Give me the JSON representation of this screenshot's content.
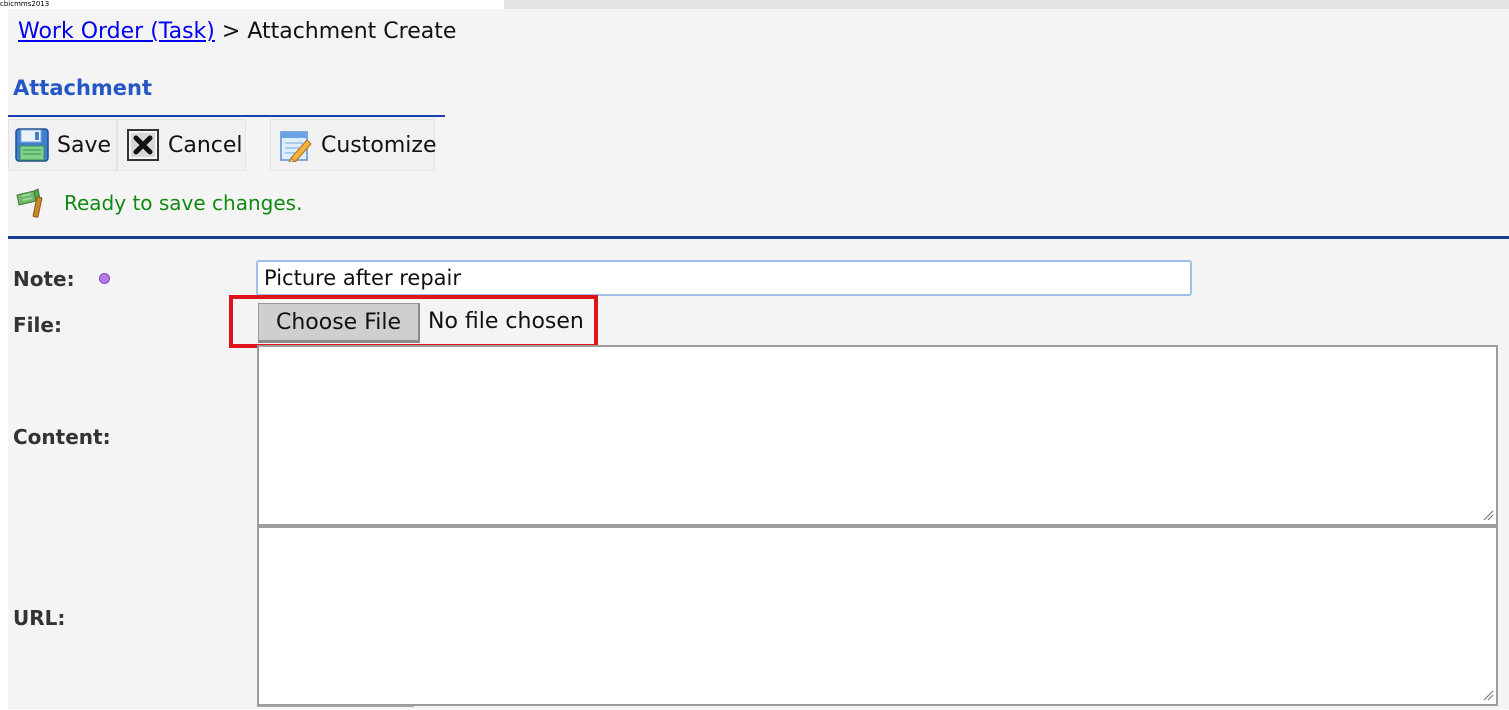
{
  "window": {
    "app_label": "cbicmms2013"
  },
  "breadcrumb": {
    "parent_link": "Work Order (Task)",
    "separator": ">",
    "current": "Attachment Create"
  },
  "section": {
    "title": "Attachment"
  },
  "toolbar": {
    "save_label": "Save",
    "cancel_label": "Cancel",
    "customize_label": "Customize"
  },
  "status": {
    "message": "Ready to save changes."
  },
  "form": {
    "note_label": "Note:",
    "note_value": "Picture after repair",
    "file_label": "File:",
    "choose_file_label": "Choose File",
    "file_status": "No file chosen",
    "content_label": "Content:",
    "content_value": "",
    "url_label": "URL:",
    "url_value": ""
  },
  "icons": {
    "save": "floppy-disk-icon",
    "cancel": "close-box-icon",
    "customize": "pencil-document-icon",
    "status": "green-flag-icon",
    "required": "required-dot-icon"
  },
  "colors": {
    "link": "#0000ee",
    "section_title": "#2457c5",
    "status_text": "#118a11",
    "highlight": "#e0131a"
  }
}
